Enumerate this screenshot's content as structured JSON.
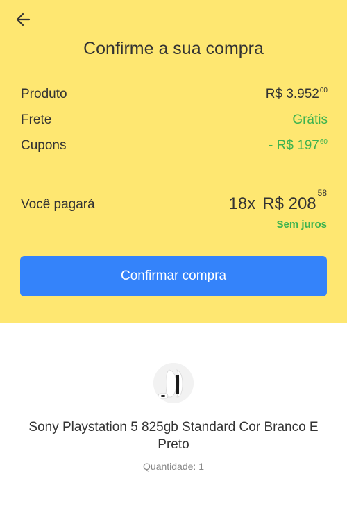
{
  "header": {
    "title": "Confirme a sua compra",
    "back_icon": "arrow-left-icon"
  },
  "summary": {
    "product": {
      "label": "Produto",
      "value": "R$ 3.952",
      "cents": "00"
    },
    "shipping": {
      "label": "Frete",
      "value": "Grátis"
    },
    "coupons": {
      "label": "Cupons",
      "value": "- R$ 197",
      "cents": "60"
    }
  },
  "payment": {
    "label": "Você pagará",
    "installments": "18x",
    "amount": "R$ 208",
    "cents": "58",
    "interest": "Sem juros"
  },
  "confirm_button": {
    "label": "Confirmar compra"
  },
  "product": {
    "name": "Sony Playstation 5 825gb Standard Cor Branco E Preto",
    "quantity": "Quantidade: 1"
  },
  "colors": {
    "accent_yellow": "#fee771",
    "button_blue": "#3483fa",
    "green": "#3db34f"
  }
}
